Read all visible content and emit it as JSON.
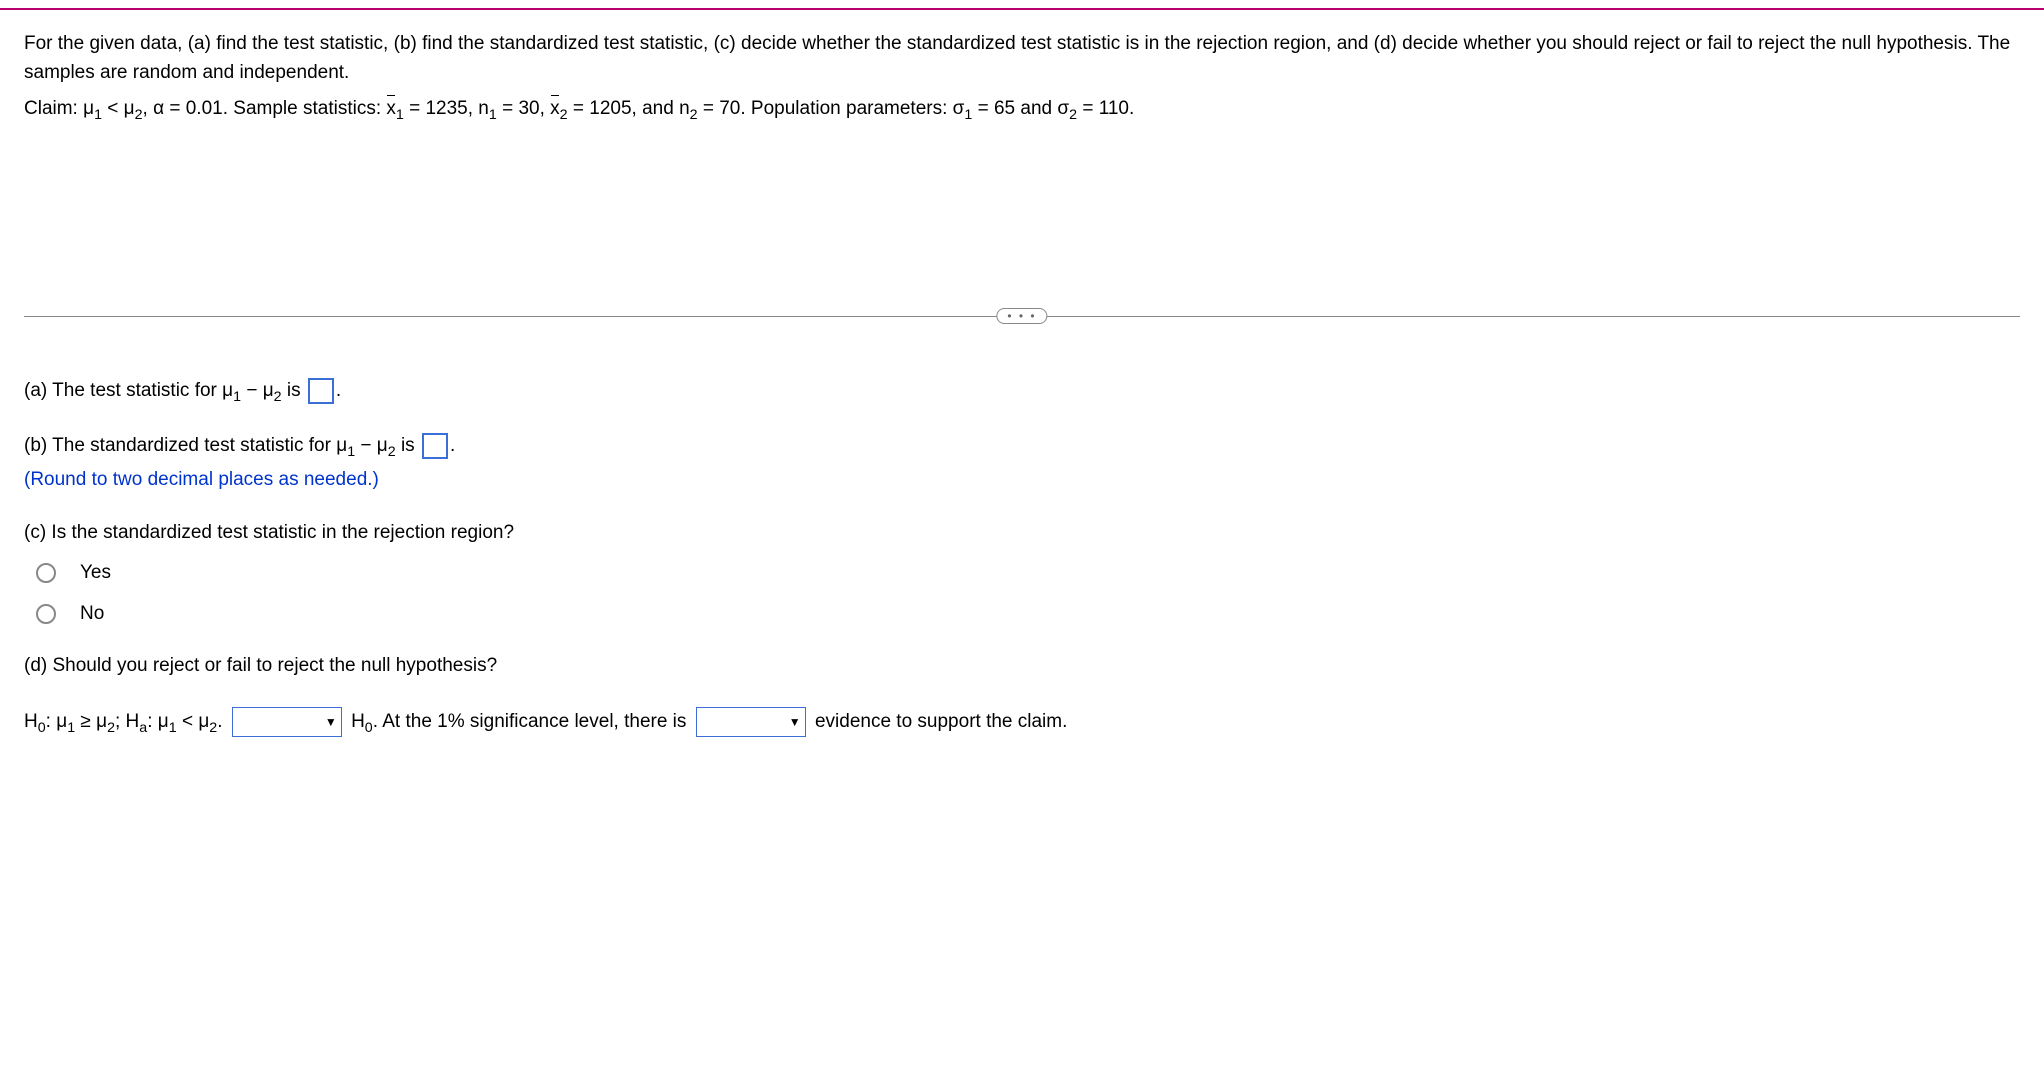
{
  "problem": {
    "intro": "For the given data, (a) find the test statistic, (b) find the standardized test statistic, (c) decide whether the standardized test statistic is in the rejection region, and (d) decide whether you should reject or fail to reject the null hypothesis. The samples are random and independent.",
    "claim_prefix": "Claim: μ",
    "claim_sub1": "1",
    "claim_lt": " < μ",
    "claim_sub2": "2",
    "claim_alpha": ", α = 0.01. Sample statistics: ",
    "xbar1_label": "x",
    "xbar1_sub": "1",
    "xbar1_val": " = 1235, n",
    "n1_sub": "1",
    "n1_val": " = 30, ",
    "xbar2_label": "x",
    "xbar2_sub": "2",
    "xbar2_val": " = 1205, and n",
    "n2_sub": "2",
    "n2_val": " = 70. Population parameters: σ",
    "sigma1_sub": "1",
    "sigma1_val": " = 65 and σ",
    "sigma2_sub": "2",
    "sigma2_val": " = 110."
  },
  "divider_dots": "• • •",
  "parts": {
    "a_prefix": "(a) The test statistic for μ",
    "a_sub1": "1",
    "a_minus": " − μ",
    "a_sub2": "2",
    "a_is": " is ",
    "a_period": ".",
    "b_prefix": "(b) The standardized test statistic for μ",
    "b_sub1": "1",
    "b_minus": " − μ",
    "b_sub2": "2",
    "b_is": " is ",
    "b_period": ".",
    "b_hint": "(Round to two decimal places as needed.)",
    "c_text": "(c) Is the standardized test statistic in the rejection region?",
    "c_yes": "Yes",
    "c_no": "No",
    "d_text": "(d) Should you reject or fail to reject the null hypothesis?",
    "d_h0_prefix": "H",
    "d_h0_sub": "0",
    "d_h0_colon": ": μ",
    "d_h0_mu1": "1",
    "d_h0_ge": " ≥ μ",
    "d_h0_mu2": "2",
    "d_h0_semi": "; H",
    "d_ha_sub": "a",
    "d_ha_colon": ": μ",
    "d_ha_mu1": "1",
    "d_ha_lt": " < μ",
    "d_ha_mu2": "2",
    "d_ha_period": ". ",
    "d_mid1_a": " H",
    "d_mid1_sub": "0",
    "d_mid1_b": ". At the 1% significance level, there is ",
    "d_mid2": " evidence to support the claim."
  }
}
